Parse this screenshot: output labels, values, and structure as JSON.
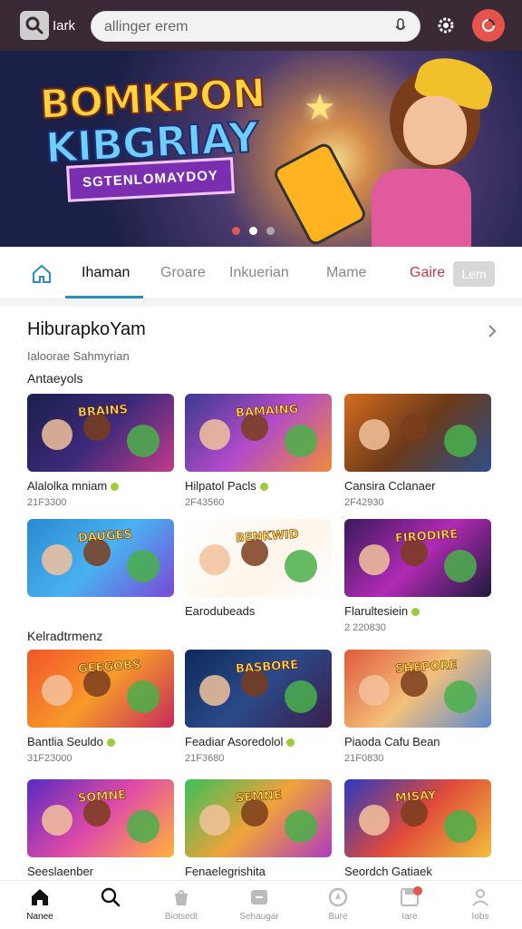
{
  "header": {
    "logo_text": "Iark",
    "search_value": "allinger erem",
    "search_placeholder": "",
    "icons": [
      "search-logo-icon",
      "mic-icon",
      "gear-icon",
      "profile-icon"
    ],
    "accent_color": "#e5534b",
    "bar_color": "#3a2a36"
  },
  "hero": {
    "title_line1": "BOMKPON",
    "title_line2": "KIBGRIAY",
    "ribbon": "SGTENLOMAYDOY",
    "slides": 3,
    "active_slide": 2
  },
  "tabs": {
    "items": [
      "Ihaman",
      "Groare",
      "Inkuerian",
      "Mame",
      "Gaire"
    ],
    "active_index": 0,
    "pill_label": "Lem",
    "accent_color": "#2b8fb8"
  },
  "section": {
    "title": "HiburapkoYam",
    "subtitle": "Ialoorae Sahmyrian",
    "group1": "Antaeyols",
    "group2": "Kelradtrmenz"
  },
  "cards": [
    {
      "name": "Alalolka mniam",
      "meta": "21F3300",
      "badge": true
    },
    {
      "name": "Hilpatol Pacls",
      "meta": "2F43560",
      "badge": true
    },
    {
      "name": "Cansira Cclanaer",
      "meta": "2F42930",
      "badge": false
    },
    {
      "name": "",
      "meta": "",
      "badge": false
    },
    {
      "name": "Earodubeads",
      "meta": "",
      "badge": false
    },
    {
      "name": "Flarultesiein",
      "meta": "2 220830",
      "badge": true
    },
    {
      "name": "Bantlia Seuldo",
      "meta": "31F23000",
      "badge": true
    },
    {
      "name": "Feadiar Asoredolol",
      "meta": "21F3680",
      "badge": true
    },
    {
      "name": "Piaoda Cafu Bean",
      "meta": "21F0830",
      "badge": false
    },
    {
      "name": "Seeslaenber",
      "meta": "",
      "badge": false
    },
    {
      "name": "Fenaelegrishita",
      "meta": "",
      "badge": false
    },
    {
      "name": "Seordch Gatiaek",
      "meta": "",
      "badge": false
    }
  ],
  "thumb_words": [
    "BRAINS",
    "BAMAING",
    "",
    "DAUGES",
    "BENKWID",
    "FIRODIRE",
    "GEEGOBS",
    "BASBORE",
    "SHEPORE",
    "SOMNE",
    "SEMNE",
    "MISAY"
  ],
  "bottom_nav": [
    {
      "label": "Nanee",
      "icon": "home-icon"
    },
    {
      "label": "",
      "icon": "search-icon"
    },
    {
      "label": "Biotsedt",
      "icon": "bag-icon"
    },
    {
      "label": "Sehaugar",
      "icon": "controller-icon"
    },
    {
      "label": "Bure",
      "icon": "compass-icon"
    },
    {
      "label": "Iare",
      "icon": "save-icon"
    },
    {
      "label": "Iobs",
      "icon": "user-icon"
    }
  ]
}
